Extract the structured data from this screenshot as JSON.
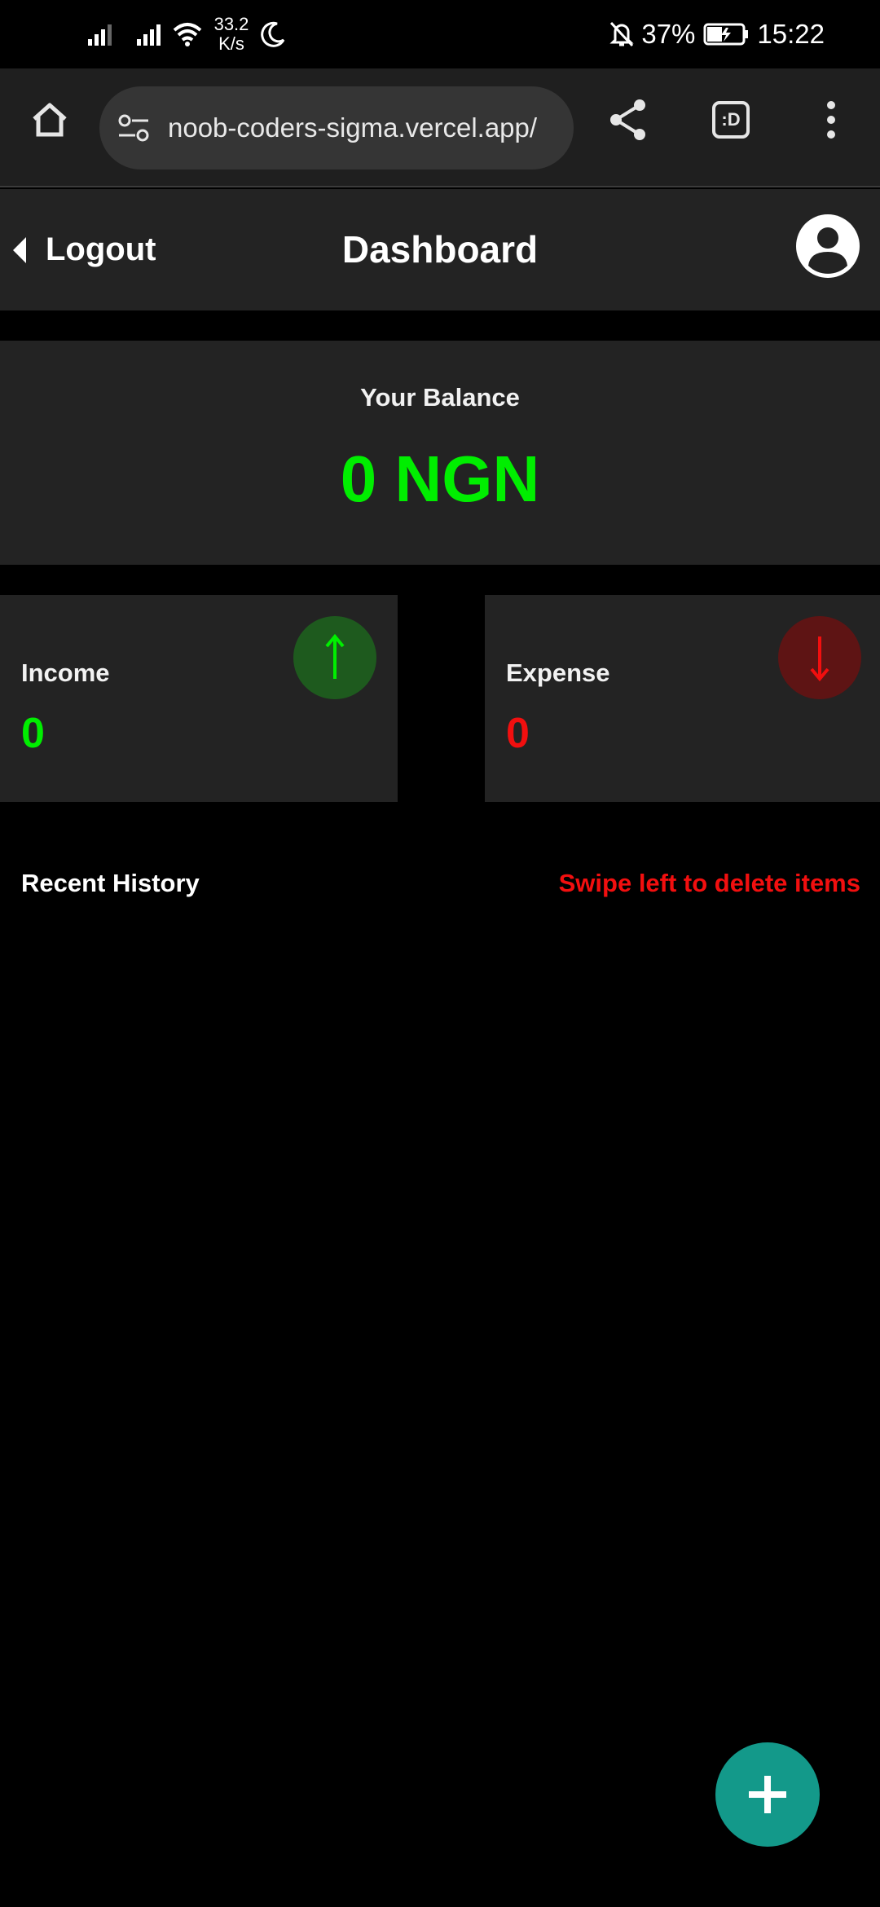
{
  "status_bar": {
    "net_speed_value": "33.2",
    "net_speed_unit": "K/s",
    "battery_percent": "37%",
    "time": "15:22"
  },
  "browser": {
    "url": "noob-coders-sigma.vercel.app/",
    "tab_switcher_label": ":D"
  },
  "header": {
    "logout_label": "Logout",
    "title": "Dashboard"
  },
  "balance": {
    "label": "Your Balance",
    "value": "0 NGN"
  },
  "income": {
    "label": "Income",
    "value": "0"
  },
  "expense": {
    "label": "Expense",
    "value": "0"
  },
  "history": {
    "title": "Recent History",
    "hint": "Swipe left to delete items",
    "items": []
  },
  "colors": {
    "balance": "#00ee00",
    "income": "#00ee00",
    "expense": "#f20f0f",
    "fab": "#13998a"
  },
  "icons": {
    "home": "home-icon",
    "site_settings": "tune-icon",
    "share": "share-icon",
    "menu": "more-vertical-icon",
    "back": "caret-left-icon",
    "avatar": "user-circle-icon",
    "income": "arrow-up-icon",
    "expense": "arrow-down-icon",
    "add": "plus-icon"
  }
}
